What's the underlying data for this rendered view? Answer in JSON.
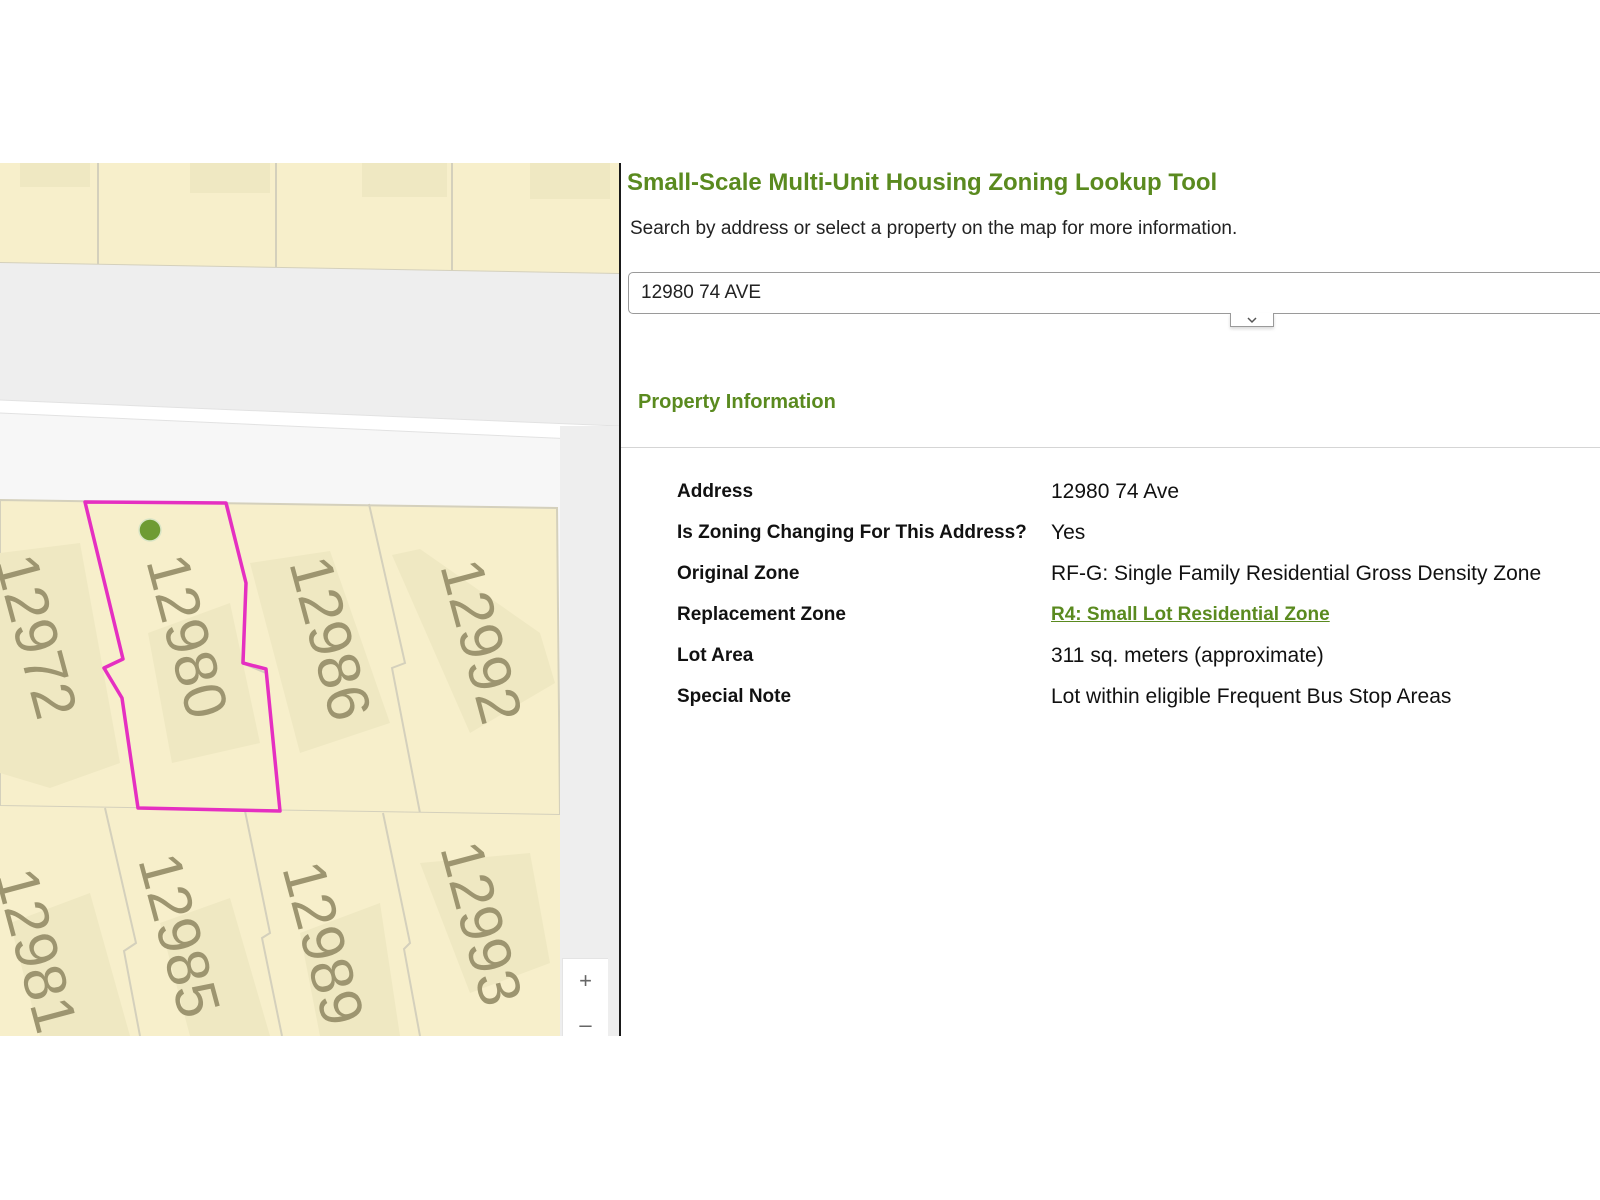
{
  "app": {
    "title": "Small-Scale Multi-Unit Housing Zoning Lookup Tool",
    "instructions": "Search by address or select a property on the map for more information."
  },
  "search": {
    "value": "12980 74 AVE",
    "dropdown_icon": "chevron-down-icon"
  },
  "map": {
    "selected_lot": "12980",
    "lots": [
      "12972",
      "12980",
      "12986",
      "12992",
      "12981",
      "12985",
      "12989",
      "12993"
    ],
    "zoom_in_label": "+",
    "zoom_out_label": "–",
    "colors": {
      "lot_fill": "#f7efcb",
      "building_fill": "#efe8c2",
      "lot_label": "#9d9570",
      "selected_outline": "#e52fc1",
      "marker": "#6e9b33"
    }
  },
  "property": {
    "section_title": "Property Information",
    "rows": [
      {
        "label": "Address",
        "value": "12980 74 Ave"
      },
      {
        "label": "Is Zoning Changing For This Address?",
        "value": "Yes"
      },
      {
        "label": "Original Zone",
        "value": "RF-G: Single Family Residential Gross Density Zone"
      },
      {
        "label": "Replacement Zone",
        "value": "R4: Small Lot Residential Zone"
      },
      {
        "label": "Lot Area",
        "value": "311 sq. meters (approximate)"
      },
      {
        "label": "Special Note",
        "value": "Lot within eligible Frequent Bus Stop Areas"
      }
    ]
  },
  "colors": {
    "accent": "#5a8a1f",
    "text": "#111111"
  }
}
